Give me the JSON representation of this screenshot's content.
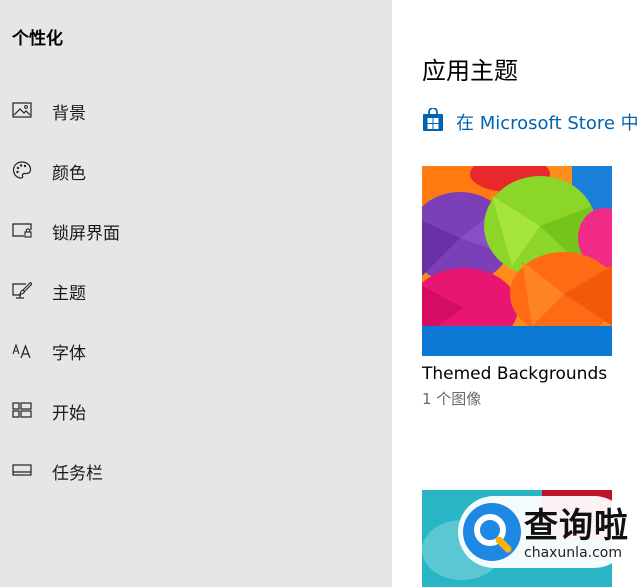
{
  "sidebar": {
    "title": "个性化",
    "items": [
      {
        "label": "背景",
        "icon": "picture-icon"
      },
      {
        "label": "颜色",
        "icon": "palette-icon"
      },
      {
        "label": "锁屏界面",
        "icon": "lock-screen-icon"
      },
      {
        "label": "主题",
        "icon": "theme-brush-icon"
      },
      {
        "label": "字体",
        "icon": "font-icon"
      },
      {
        "label": "开始",
        "icon": "start-tiles-icon"
      },
      {
        "label": "任务栏",
        "icon": "taskbar-icon"
      }
    ]
  },
  "main": {
    "title": "应用主题",
    "store_link": "在 Microsoft Store 中获",
    "themes": [
      {
        "name": "Themed Backgrounds",
        "count": "1 个图像"
      }
    ]
  },
  "watermark": {
    "text": "查询啦",
    "domain": "chaxunla.com"
  },
  "colors": {
    "sidebar_bg": "#e6e6e6",
    "accent": "#0063b1",
    "theme_bar": "#0a78d4"
  }
}
